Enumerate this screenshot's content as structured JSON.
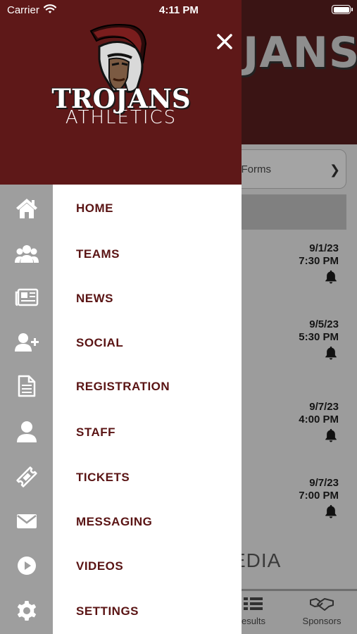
{
  "status_bar": {
    "carrier": "Carrier",
    "time": "4:11 PM"
  },
  "background": {
    "hero_text": "JANS",
    "forms_label": "d Forms",
    "games": [
      {
        "date": "9/1/23",
        "time": "7:30 PM"
      },
      {
        "date": "9/5/23",
        "time": "5:30 PM"
      },
      {
        "date": "9/7/23",
        "time": "4:00 PM"
      },
      {
        "date": "9/7/23",
        "time": "7:00 PM"
      }
    ],
    "media_label": "EDIA",
    "tabs": [
      {
        "label": "esults",
        "icon": "list-icon"
      },
      {
        "label": "Sponsors",
        "icon": "handshake-icon"
      }
    ]
  },
  "drawer": {
    "logo": {
      "title": "TROJANS",
      "subtitle": "ATHLETICS"
    },
    "colors": {
      "header": "#5e1818",
      "menu_text": "#5a1414",
      "rail": "#9e9e9e"
    },
    "menu": [
      {
        "label": "HOME",
        "icon": "home-icon"
      },
      {
        "label": "TEAMS",
        "icon": "team-icon"
      },
      {
        "label": "NEWS",
        "icon": "newspaper-icon"
      },
      {
        "label": "SOCIAL",
        "icon": "add-user-icon"
      },
      {
        "label": "REGISTRATION",
        "icon": "document-icon"
      },
      {
        "label": "STAFF",
        "icon": "person-icon"
      },
      {
        "label": "TICKETS",
        "icon": "ticket-icon"
      },
      {
        "label": "MESSAGING",
        "icon": "envelope-icon"
      },
      {
        "label": "VIDEOS",
        "icon": "play-icon"
      },
      {
        "label": "SETTINGS",
        "icon": "gear-icon"
      }
    ]
  }
}
